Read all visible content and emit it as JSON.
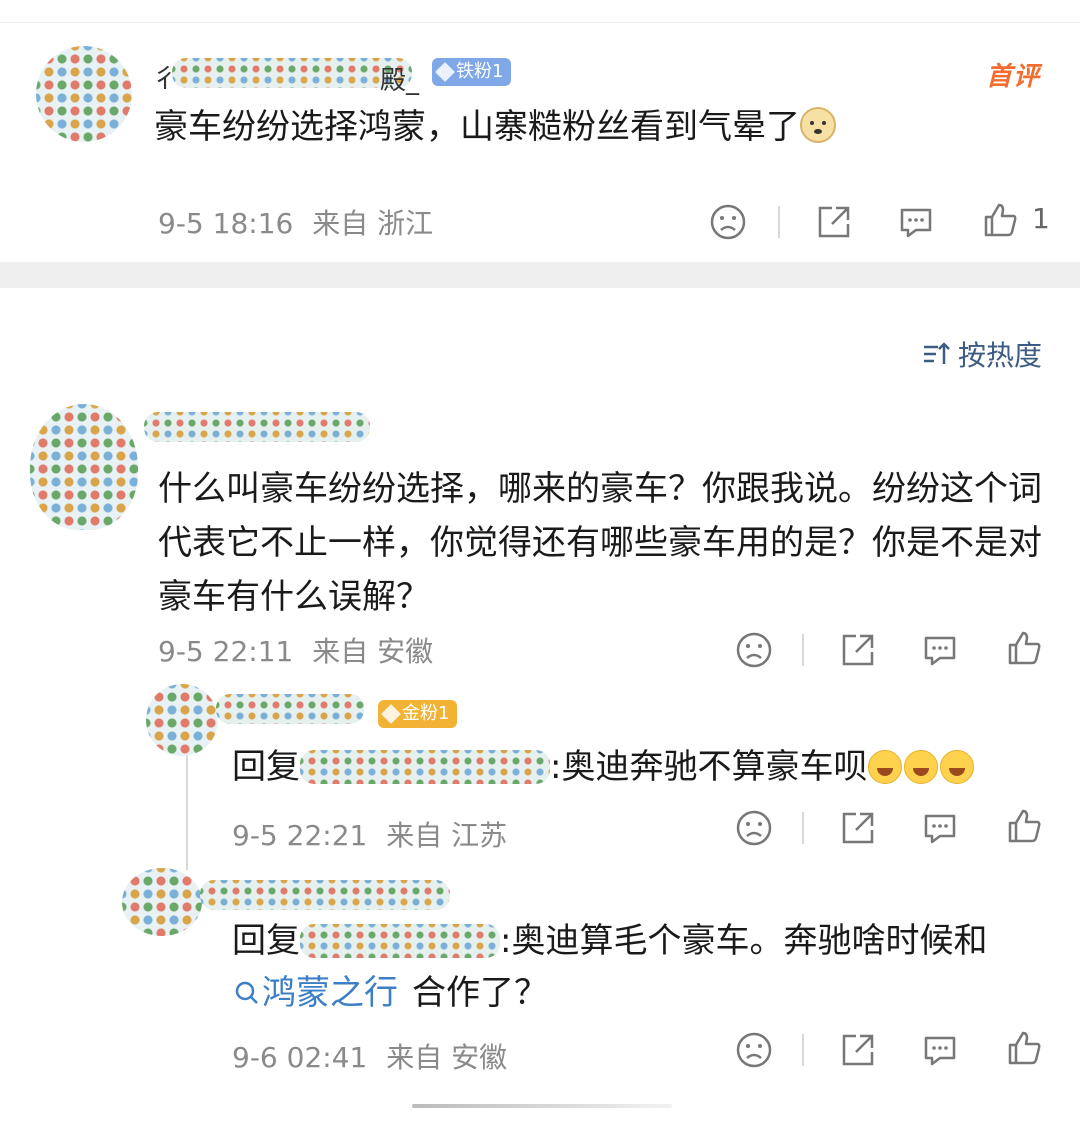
{
  "comment1": {
    "name_prefix": "彳",
    "name_suffix": "殿_",
    "badge": "铁粉1",
    "hot_label": "首评",
    "text": "豪车纷纷选择鸿蒙，山寨糙粉丝看到气晕了",
    "time": "9-5 18:16",
    "from": "来自 浙江",
    "like_count": "1"
  },
  "sort": {
    "label": "按热度"
  },
  "comment2": {
    "text": "什么叫豪车纷纷选择，哪来的豪车？你跟我说。纷纷这个词代表它不止一样，你觉得还有哪些豪车用的是？你是不是对豪车有什么误解？",
    "time": "9-5 22:11",
    "from": "来自 安徽"
  },
  "reply1": {
    "badge": "金粉1",
    "prefix": "回复",
    "tail": ":奥迪奔驰不算豪车呗",
    "time": "9-5 22:21",
    "from": "来自 江苏"
  },
  "reply2": {
    "prefix": "回复",
    "tail": ":奥迪算毛个豪车。奔驰啥时候和",
    "topic": "鸿蒙之行",
    "end": "合作了？",
    "time": "9-6 02:41",
    "from": "来自 安徽"
  },
  "icons": [
    "sad-face-icon",
    "share-icon",
    "comment-icon",
    "like-thumb-icon",
    "search-icon",
    "sort-icon"
  ],
  "colors": {
    "link": "#3d7fc6",
    "meta": "#8a8a8a",
    "iron_badge": "#7fa8e8",
    "gold_badge": "#f2b233",
    "hot": "#f26d2e"
  }
}
